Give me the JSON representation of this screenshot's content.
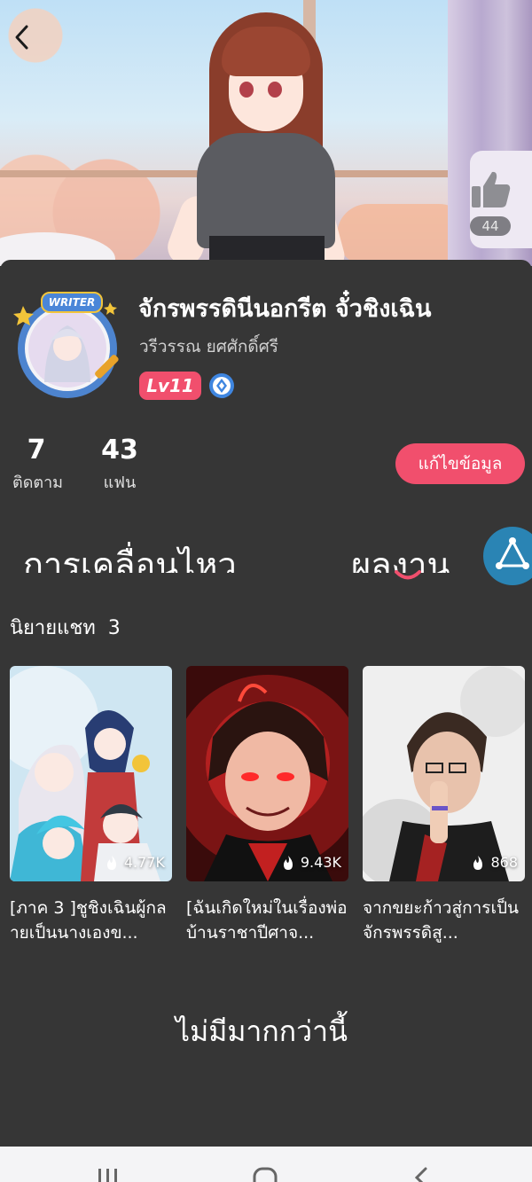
{
  "banner": {
    "like_count": "44"
  },
  "profile": {
    "avatar_badge": "WRITER",
    "name": "จักรพรรดินีนอกรีต จั๋วชิงเฉิน",
    "subname": "วรีวรรณ ยศศักดิ์ศรี",
    "level": "Lv11",
    "stats": [
      {
        "value": "7",
        "label": "ติดตาม"
      },
      {
        "value": "43",
        "label": "แฟน"
      }
    ],
    "edit_label": "แก้ไขข้อมูล"
  },
  "tabs": [
    {
      "label": "การเคลื่อนไหว",
      "active": false
    },
    {
      "label": "ผลงาน",
      "active": true
    }
  ],
  "section": {
    "title": "นิยายแชท",
    "count": "3"
  },
  "novels": [
    {
      "title": "[ภาค 3 ]ชูชิงเฉินผู้กลายเป็นนางเองข...",
      "views": "4.77K"
    },
    {
      "title": "[ฉันเกิดใหม่ในเรื่องพ่อบ้านราชาปีศาจ...",
      "views": "9.43K"
    },
    {
      "title": "จากขยะก้าวสู่การเป็นจักรพรรดิสู...",
      "views": "868"
    }
  ],
  "footer_text": "ไม่มีมากกว่านี้",
  "colors": {
    "accent": "#f14f6d",
    "background": "#363636",
    "fab": "#2a84b4"
  },
  "icons": [
    "back-arrow-icon",
    "thumbs-up-icon",
    "verified-icon",
    "triangle-share-icon",
    "fire-icon",
    "recent-apps-icon",
    "home-icon",
    "nav-back-icon"
  ]
}
